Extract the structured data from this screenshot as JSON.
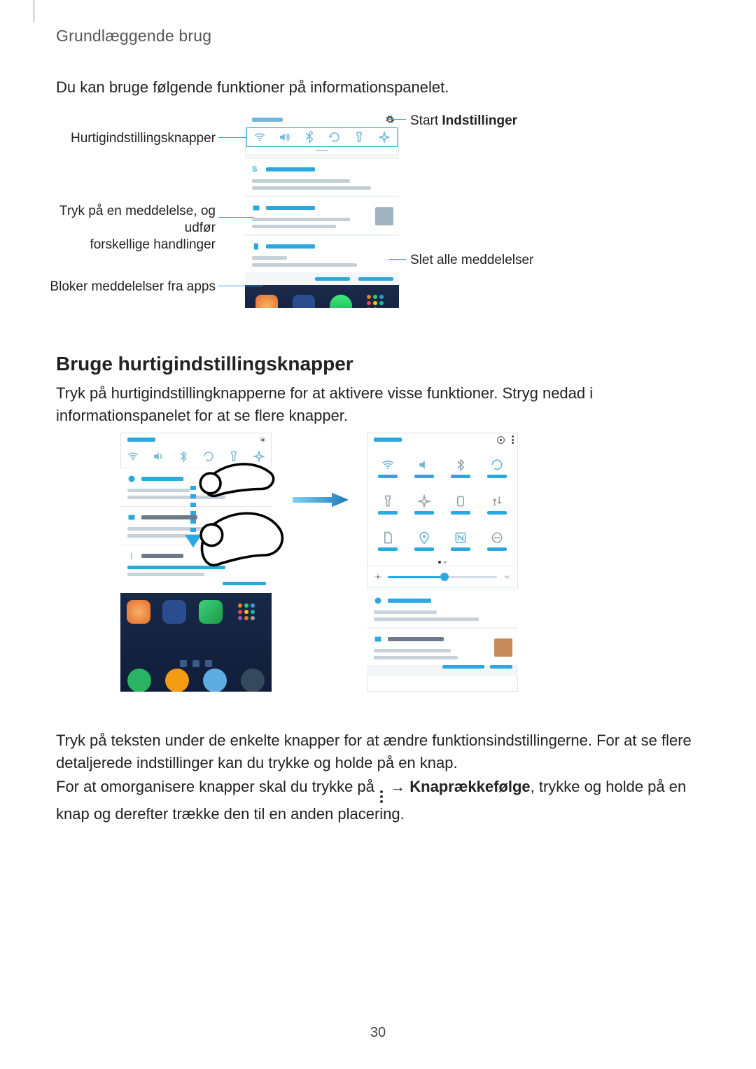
{
  "header": {
    "section": "Grundlæggende brug"
  },
  "intro": "Du kan bruge følgende funktioner på informationspanelet.",
  "callouts": {
    "quick_buttons": "Hurtigindstillingsknapper",
    "start_settings_pre": "Start ",
    "start_settings_bold": "Indstillinger",
    "tap_notif_l1": "Tryk på en meddelelse, og udfør",
    "tap_notif_l2": "forskellige handlinger",
    "clear_all": "Slet alle meddelelser",
    "block_apps": "Bloker meddelelser fra apps"
  },
  "section_heading": "Bruge hurtigindstillingsknapper",
  "section_p": "Tryk på hurtigindstillingknapperne for at aktivere visse funktioner. Stryg nedad i informationspanelet for at se flere knapper.",
  "tail_p1": "Tryk på teksten under de enkelte knapper for at ændre funktionsindstillingerne. For at se flere detaljerede indstillinger kan du trykke og holde på en knap.",
  "tail_p2_pre": "For at omorganisere knapper skal du trykke på ",
  "tail_p2_arrow": " → ",
  "tail_p2_bold": "Knaprækkefølge",
  "tail_p2_post": ", trykke og holde på en knap og derefter trække den til en anden placering.",
  "page_number": "30",
  "brand_accent": "#2aa8e0"
}
